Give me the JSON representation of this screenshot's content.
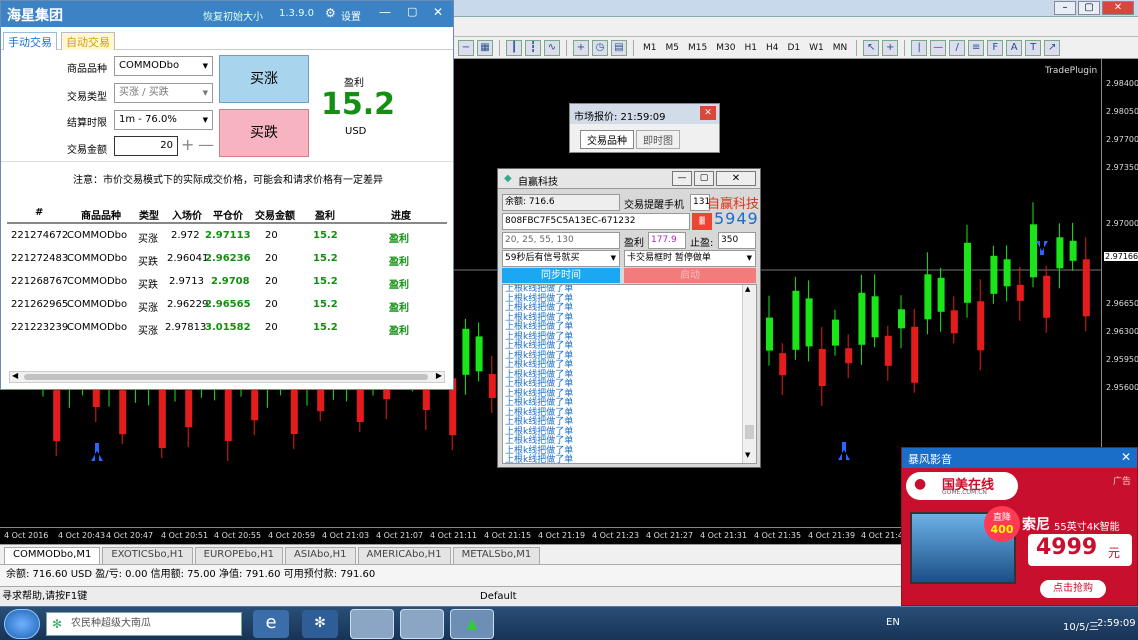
{
  "tool": {
    "title": "海星集团",
    "restore_size": "恢复初始大小",
    "version": "1.3.9.0",
    "settings": "设置",
    "tabs": [
      "手动交易",
      "自动交易"
    ],
    "form": {
      "symbol_label": "商品品种",
      "symbol_value": "COMMODbo",
      "type_label": "交易类型",
      "type_value": "买涨 / 买跌",
      "expiry_label": "结算时限",
      "expiry_value": "1m - 76.0%",
      "amount_label": "交易金额",
      "amount_value": "20"
    },
    "buy_up": "买涨",
    "buy_down": "买跌",
    "profit_label": "盈利",
    "profit_value": "15.2",
    "profit_unit": "USD",
    "notice": "注意：市价交易模式下的实际成交价格，可能会和请求价格有一定差异",
    "columns": [
      "#",
      "商品品种",
      "类型",
      "入场价",
      "平仓价",
      "交易金额",
      "盈利",
      "进度"
    ],
    "orders": [
      {
        "id": "221274672",
        "symbol": "COMMODbo",
        "type": "买涨",
        "entry": "2.972",
        "close": "2.97113",
        "amount": "20",
        "profit": "15.2",
        "status": "盈利"
      },
      {
        "id": "221272483",
        "symbol": "COMMODbo",
        "type": "买跌",
        "entry": "2.96041",
        "close": "2.96236",
        "amount": "20",
        "profit": "15.2",
        "status": "盈利"
      },
      {
        "id": "221268767",
        "symbol": "COMMODbo",
        "type": "买跌",
        "entry": "2.9713",
        "close": "2.9708",
        "amount": "20",
        "profit": "15.2",
        "status": "盈利"
      },
      {
        "id": "221262965",
        "symbol": "COMMODbo",
        "type": "买涨",
        "entry": "2.96229",
        "close": "2.96565",
        "amount": "20",
        "profit": "15.2",
        "status": "盈利"
      },
      {
        "id": "221223239",
        "symbol": "COMMODbo",
        "type": "买涨",
        "entry": "2.97813",
        "close": "3.01582",
        "amount": "20",
        "profit": "15.2",
        "status": "盈利"
      }
    ]
  },
  "mt": {
    "timeframes": [
      "M1",
      "M5",
      "M15",
      "M30",
      "H1",
      "H4",
      "D1",
      "W1",
      "MN"
    ],
    "plugin_label": "TradePlugin",
    "prices": [
      "2.98400",
      "2.98050",
      "2.97700",
      "2.97350",
      "2.97000",
      "2.96650",
      "2.96300",
      "2.95950",
      "2.95600"
    ],
    "current_price": "2.97166",
    "times": [
      "4 Oct 2016",
      "4 Oct 20:43",
      "4 Oct 20:47",
      "4 Oct 20:51",
      "4 Oct 20:55",
      "4 Oct 20:59",
      "4 Oct 21:03",
      "4 Oct 21:07",
      "4 Oct 21:11",
      "4 Oct 21:15",
      "4 Oct 21:19",
      "4 Oct 21:23",
      "4 Oct 21:27",
      "4 Oct 21:31",
      "4 Oct 21:35",
      "4 Oct 21:39",
      "4 Oct 21:43"
    ],
    "chart_tabs": [
      "COMMODbo,M1",
      "EXOTICSbo,H1",
      "EUROPEbo,H1",
      "ASIAbo,H1",
      "AMERICAbo,H1",
      "METALSbo,M1"
    ],
    "account_line": "余额: 716.60 USD  盈/亏: 0.00  信用额: 75.00  净值: 791.60  可用预付款: 791.60",
    "help_text": "寻求帮助,请按F1键",
    "profile": "Default"
  },
  "market_window": {
    "title": "市场报价: 21:59:09",
    "tabs": [
      "交易品种",
      "即时图"
    ]
  },
  "robot": {
    "title": "自赢科技",
    "balance": "余额: 716.6",
    "phone_label": "交易提醒手机",
    "phone_value": "131",
    "brand": "自赢科技",
    "key": "808FBC7F5C5A13EC-671232",
    "captcha_code": "5949",
    "numbers": "20, 25, 55, 130",
    "profit_label": "盈利",
    "profit_value": "177.9",
    "stop_label": "止盈:",
    "stop_value": "350",
    "signal_select": "59秒后有信号就买",
    "pause_select": "卡交易框时 暂停做单",
    "sync_btn": "同步时间",
    "start_btn": "启动",
    "log_line": "上根k线把做了单",
    "log_count": 23,
    "log_final": "**********时间过了,开始监测下一根k线"
  },
  "ad": {
    "header": "暴风影音",
    "ad_tag": "广告",
    "brand": "国美在线",
    "brand_url": "GOME.COM.CN",
    "discount_label": "直降",
    "discount_value": "400",
    "product": "索尼",
    "product_desc": "55英寸4K智能",
    "price": "4999",
    "price_unit": "元",
    "cta": "点击抢购"
  },
  "taskbar": {
    "search_placeholder": "农民种超级大南瓜",
    "lang": "EN",
    "time": "2:59:09",
    "date": "10/5/三"
  },
  "colors": {
    "bull": "#19e519",
    "bear": "#e51c1c",
    "titlebar": "#3c83c5",
    "profit": "#129012"
  }
}
